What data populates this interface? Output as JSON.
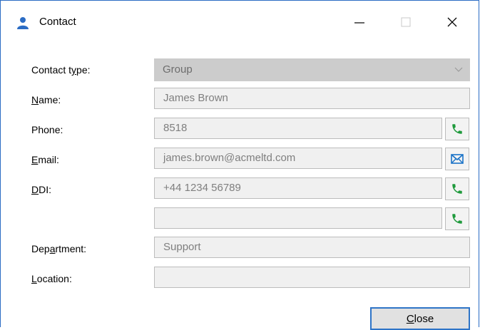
{
  "window": {
    "title": "Contact",
    "icon": "person-icon",
    "controls": {
      "minimize": "—",
      "maximize": "□",
      "close": "✕"
    }
  },
  "form": {
    "contact_type": {
      "label_pre": "Contact t",
      "label_u": "y",
      "label_post": "pe:",
      "value": "Group"
    },
    "name": {
      "label_u": "N",
      "label_post": "ame:",
      "value": "James Brown"
    },
    "phone": {
      "label": "Phone:",
      "value": "8518"
    },
    "email": {
      "label_u": "E",
      "label_post": "mail:",
      "value": "james.brown@acmeltd.com"
    },
    "ddi": {
      "label_u": "D",
      "label_post": "DI:",
      "value": "+44 1234 56789"
    },
    "ddi2": {
      "value": ""
    },
    "department": {
      "label_pre": "Dep",
      "label_u": "a",
      "label_post": "rtment:",
      "value": "Support"
    },
    "location": {
      "label_u": "L",
      "label_post": "ocation:",
      "value": ""
    }
  },
  "buttons": {
    "close_u": "C",
    "close_post": "lose"
  },
  "colors": {
    "accent": "#2e74c7",
    "phone_green": "#1f9a3c",
    "mail_blue": "#1a73c7"
  }
}
